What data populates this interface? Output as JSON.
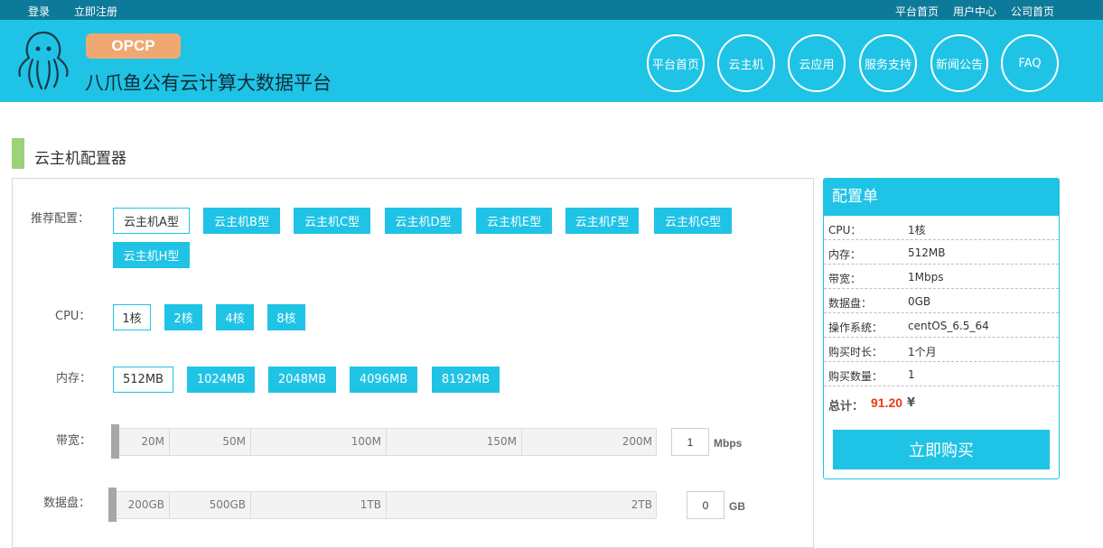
{
  "topbar": {
    "login": "登录",
    "register": "立即注册",
    "platform_home": "平台首页",
    "user_center": "用户中心",
    "company_home": "公司首页"
  },
  "header": {
    "badge": "OPCP",
    "title": "八爪鱼公有云计算大数据平台",
    "nav": [
      "平台首页",
      "云主机",
      "云应用",
      "服务支持",
      "新闻公告",
      "FAQ"
    ]
  },
  "section": {
    "title": "云主机配置器"
  },
  "config": {
    "recommend_label": "推荐配置：",
    "recommend": [
      "云主机A型",
      "云主机B型",
      "云主机C型",
      "云主机D型",
      "云主机E型",
      "云主机F型",
      "云主机G型",
      "云主机H型"
    ],
    "cpu_label": "CPU：",
    "cpu": [
      "1核",
      "2核",
      "4核",
      "8核"
    ],
    "mem_label": "内存：",
    "mem": [
      "512MB",
      "1024MB",
      "2048MB",
      "4096MB",
      "8192MB"
    ],
    "bw_label": "带宽：",
    "bw_ticks": [
      "20M",
      "50M",
      "100M",
      "150M",
      "200M"
    ],
    "bw_value": "1",
    "bw_unit": "Mbps",
    "disk_label": "数据盘：",
    "disk_ticks": [
      "200GB",
      "500GB",
      "1TB",
      "2TB"
    ],
    "disk_value": "0",
    "disk_unit": "GB"
  },
  "order": {
    "title": "配置单",
    "rows": [
      {
        "k": "CPU：",
        "v": "1核"
      },
      {
        "k": "内存：",
        "v": "512MB"
      },
      {
        "k": "带宽：",
        "v": "1Mbps"
      },
      {
        "k": "数据盘：",
        "v": "0GB"
      },
      {
        "k": "操作系统：",
        "v": "centOS_6.5_64"
      },
      {
        "k": "购买时长：",
        "v": "1个月"
      },
      {
        "k": "购买数量：",
        "v": "1"
      }
    ],
    "total_label": "总计：",
    "total_value": "91.20",
    "currency": "¥",
    "buy_label": "立即购买"
  },
  "colors": {
    "accent": "#1fc3e5",
    "topbar": "#0d7a99",
    "brand_badge": "#f0a872",
    "section_marker": "#9cd27a",
    "price": "#ee3a14"
  }
}
